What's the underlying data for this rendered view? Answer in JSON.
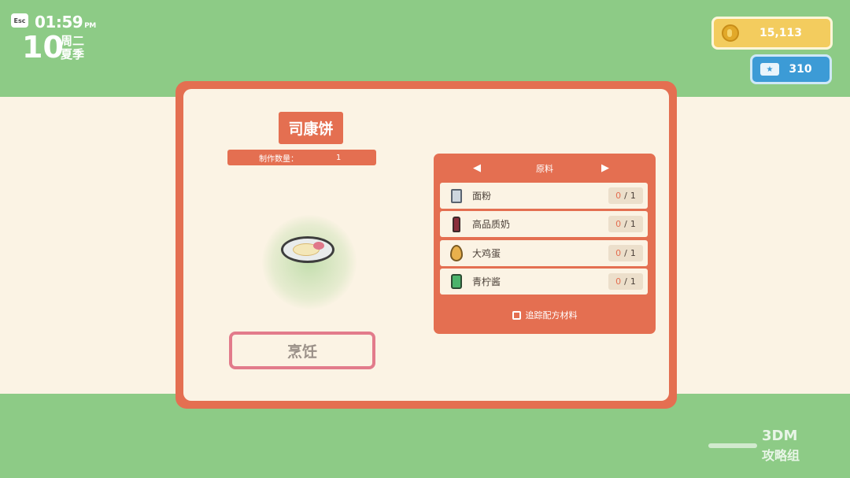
{
  "hud": {
    "esc_label": "Esc",
    "time": "01:59",
    "ampm": "PM",
    "day": "10",
    "weekday": "周二",
    "season": "夏季"
  },
  "currency": {
    "coins": "15,113",
    "tickets": "310",
    "coin_icon": "gold-coin-icon",
    "ticket_icon": "ticket-icon"
  },
  "recipe": {
    "title": "司康饼",
    "quantity_label": "制作数量：",
    "quantity_value": "1",
    "cook_label": "烹饪"
  },
  "ingredients": {
    "header": "原料",
    "items": [
      {
        "name": "面粉",
        "have": "0",
        "sep": "/",
        "need": "1",
        "icon": "flour-bag-icon"
      },
      {
        "name": "高品质奶",
        "have": "0",
        "sep": "/",
        "need": "1",
        "icon": "milk-bottle-icon"
      },
      {
        "name": "大鸡蛋",
        "have": "0",
        "sep": "/",
        "need": "1",
        "icon": "egg-icon"
      },
      {
        "name": "青柠酱",
        "have": "0",
        "sep": "/",
        "need": "1",
        "icon": "lime-jam-jar-icon"
      }
    ],
    "track_label": "追踪配方材料"
  },
  "watermark": {
    "top": "3DM",
    "bottom": "攻略组"
  },
  "colors": {
    "panel": "#e46f51",
    "cream": "#fbf3e4",
    "grass": "#8dcb86",
    "coin_bg": "#f3cc5e",
    "ticket_bg": "#3c9bd6",
    "cook_border": "#e27b8b"
  }
}
